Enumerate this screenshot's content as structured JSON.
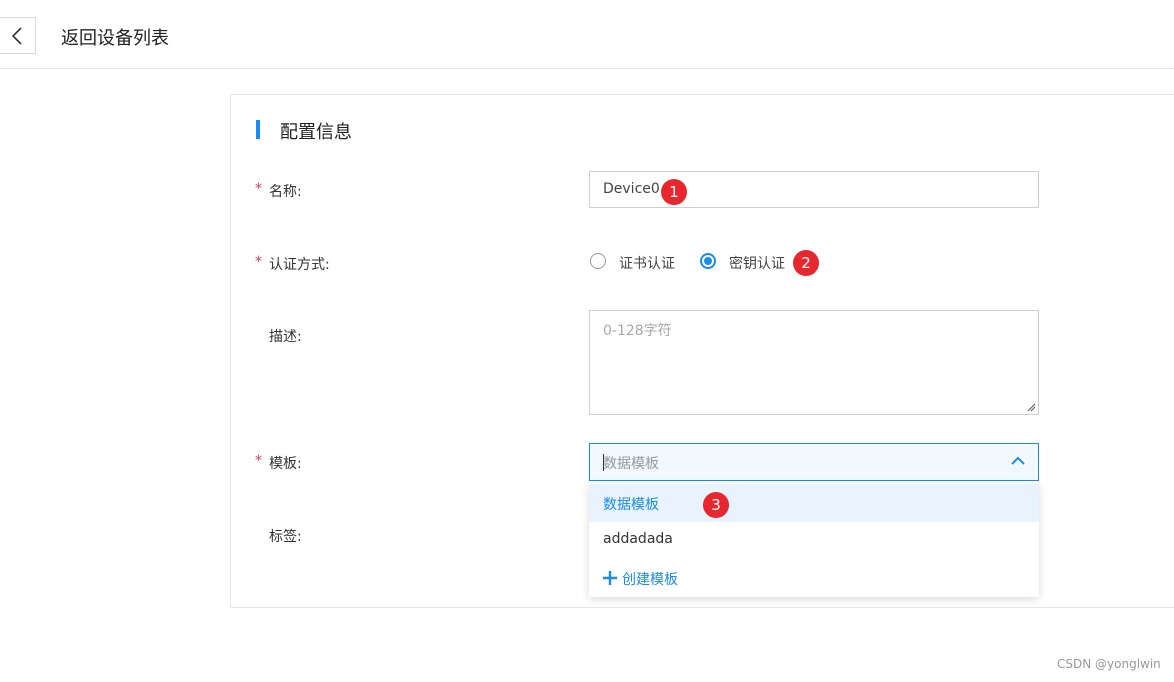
{
  "header": {
    "title": "返回设备列表"
  },
  "section": {
    "title": "配置信息"
  },
  "form": {
    "name": {
      "label": "名称:",
      "required": "*",
      "value": "Device0"
    },
    "auth": {
      "label": "认证方式:",
      "required": "*",
      "options": [
        "证书认证",
        "密钥认证"
      ],
      "selected": "密钥认证"
    },
    "desc": {
      "label": "描述:",
      "placeholder": "0-128字符"
    },
    "template": {
      "label": "模板:",
      "required": "*",
      "placeholder": "数据模板",
      "options": [
        "数据模板",
        "addadada"
      ],
      "create_label": "创建模板"
    },
    "tags": {
      "label": "标签:"
    }
  },
  "annotations": [
    "1",
    "2",
    "3"
  ],
  "watermark": "CSDN @yonglwin",
  "colors": {
    "accent": "#1a8cf0",
    "required": "#e0364f",
    "badge": "#e8262d"
  },
  "icons": {
    "back": "chevron-left-icon",
    "dropdown": "chevron-up-icon",
    "create": "plus-icon"
  }
}
